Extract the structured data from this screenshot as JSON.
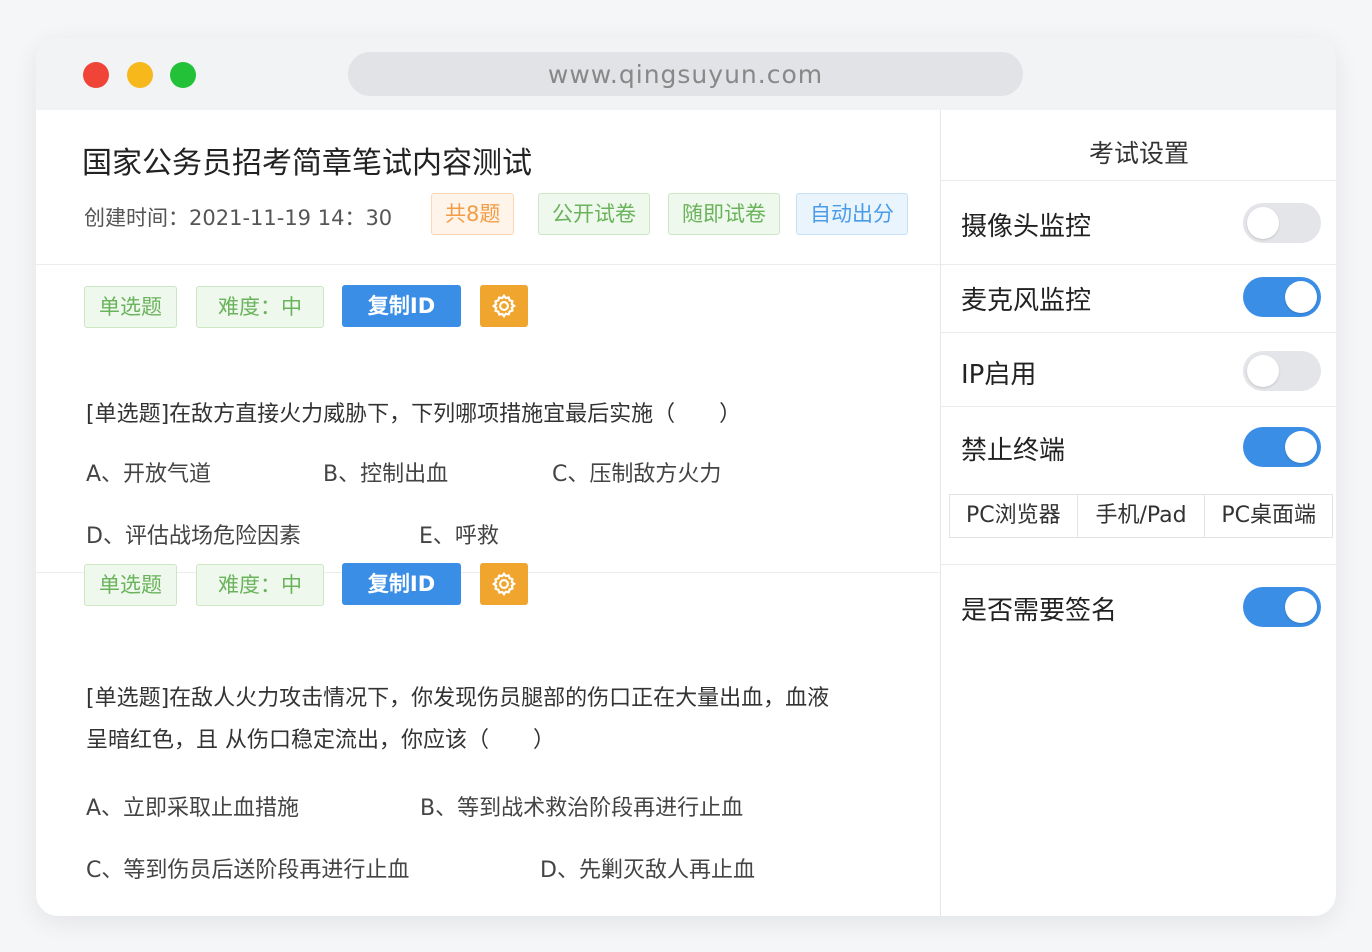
{
  "window": {
    "url": "www.qingsuyun.com"
  },
  "exam": {
    "title": "国家公务员招考简章笔试内容测试",
    "created": "创建时间：2021-11-19 14：30",
    "tags": [
      "共8题",
      "公开试卷",
      "随即试卷",
      "自动出分"
    ]
  },
  "questions": [
    {
      "type_tag": "单选题",
      "difficulty": "难度：中",
      "copy_label": "复制ID",
      "text_lines": [
        "[单选题]在敌方直接火力威胁下，下列哪项措施宜最后实施（　　）"
      ],
      "options": [
        "A、开放气道",
        "B、控制出血",
        "C、压制敌方火力",
        "D、评估战场危险因素",
        "E、呼救"
      ]
    },
    {
      "type_tag": "单选题",
      "difficulty": "难度：中",
      "copy_label": "复制ID",
      "text_lines": [
        "[单选题]在敌人火力攻击情况下，你发现伤员腿部的伤口正在大量出血，血液",
        "呈暗红色，且 从伤口稳定流出，你应该（　　）"
      ],
      "options": [
        "A、立即采取止血措施",
        "B、等到战术救治阶段再进行止血",
        "C、等到伤员后送阶段再进行止血",
        "D、先剿灭敌人再止血"
      ]
    }
  ],
  "settings": {
    "title": "考试设置",
    "items": [
      {
        "label": "摄像头监控",
        "on": false
      },
      {
        "label": "麦克风监控",
        "on": true
      },
      {
        "label": "IP启用",
        "on": false
      },
      {
        "label": "禁止终端",
        "on": true
      }
    ],
    "terminals": [
      "PC浏览器",
      "手机/Pad",
      "PC桌面端"
    ],
    "signature": {
      "label": "是否需要签名",
      "on": true
    }
  },
  "colors": {
    "accent": "#3a8ee6",
    "gear": "#f0a52e",
    "green_tag": "#6ab35c",
    "orange_tag": "#f49c45"
  },
  "icons": {
    "gear": "gear-icon"
  }
}
